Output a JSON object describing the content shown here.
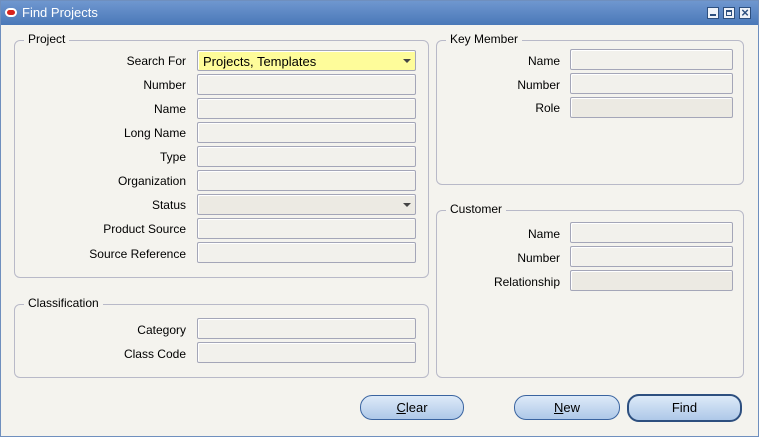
{
  "window": {
    "title": "Find Projects"
  },
  "project": {
    "legend": "Project",
    "search_for": {
      "label": "Search For",
      "value": "Projects, Templates"
    },
    "number": {
      "label": "Number",
      "value": ""
    },
    "name": {
      "label": "Name",
      "value": ""
    },
    "long_name": {
      "label": "Long Name",
      "value": ""
    },
    "type": {
      "label": "Type",
      "value": ""
    },
    "organization": {
      "label": "Organization",
      "value": ""
    },
    "status": {
      "label": "Status",
      "value": ""
    },
    "product_source": {
      "label": "Product Source",
      "value": ""
    },
    "source_reference": {
      "label": "Source Reference",
      "value": ""
    }
  },
  "classification": {
    "legend": "Classification",
    "category": {
      "label": "Category",
      "value": ""
    },
    "class_code": {
      "label": "Class Code",
      "value": ""
    }
  },
  "key_member": {
    "legend": "Key Member",
    "name": {
      "label": "Name",
      "value": ""
    },
    "number": {
      "label": "Number",
      "value": ""
    },
    "role": {
      "label": "Role",
      "value": ""
    }
  },
  "customer": {
    "legend": "Customer",
    "name": {
      "label": "Name",
      "value": ""
    },
    "number": {
      "label": "Number",
      "value": ""
    },
    "relationship": {
      "label": "Relationship",
      "value": ""
    }
  },
  "buttons": {
    "clear_mnemonic": "C",
    "clear_rest": "lear",
    "new_mnemonic": "N",
    "new_rest": "ew",
    "find": "Find"
  },
  "colors": {
    "titlebar": "#5a86c4",
    "highlight": "#fefc9a",
    "button": "#c3d7f0"
  }
}
